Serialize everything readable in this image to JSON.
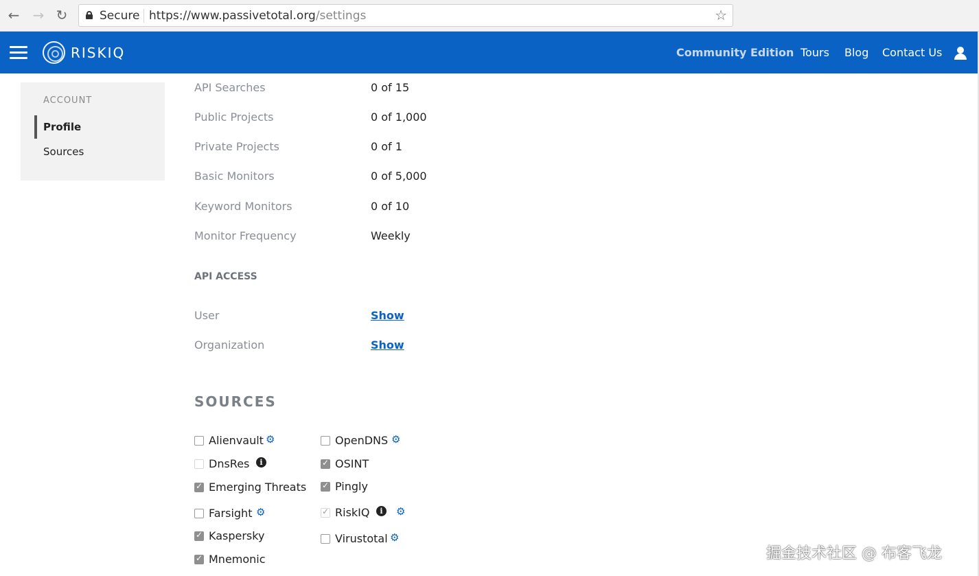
{
  "browser": {
    "secure_label": "Secure",
    "url_host": "https://www.passivetotal.org",
    "url_path": "/settings"
  },
  "header": {
    "logo_text": "RISKIQ",
    "edition": "Community Edition",
    "nav": {
      "tours": "Tours",
      "blog": "Blog",
      "contact": "Contact Us"
    }
  },
  "sidebar": {
    "heading": "ACCOUNT",
    "items": [
      {
        "label": "Profile",
        "active": true
      },
      {
        "label": "Sources",
        "active": false
      }
    ]
  },
  "quotas": [
    {
      "label": "API Searches",
      "value": "0 of 15"
    },
    {
      "label": "Public Projects",
      "value": "0 of 1,000"
    },
    {
      "label": "Private Projects",
      "value": "0 of 1"
    },
    {
      "label": "Basic Monitors",
      "value": "0 of 5,000"
    },
    {
      "label": "Keyword Monitors",
      "value": "0 of 10"
    },
    {
      "label": "Monitor Frequency",
      "value": "Weekly"
    }
  ],
  "api_access": {
    "heading": "API ACCESS",
    "rows": [
      {
        "label": "User",
        "link": "Show"
      },
      {
        "label": "Organization",
        "link": "Show"
      }
    ]
  },
  "sources": {
    "title": "SOURCES",
    "left": [
      {
        "name": "Alienvault",
        "checked": false
      },
      {
        "name": "DnsRes",
        "checked": false
      },
      {
        "name": "Emerging Threats",
        "checked": true
      },
      {
        "name": "Farsight",
        "checked": false
      },
      {
        "name": "Kaspersky",
        "checked": true
      },
      {
        "name": "Mnemonic",
        "checked": true
      }
    ],
    "right": [
      {
        "name": "OpenDNS",
        "checked": false
      },
      {
        "name": "OSINT",
        "checked": true
      },
      {
        "name": "Pingly",
        "checked": true
      },
      {
        "name": "RiskIQ",
        "checked": true
      },
      {
        "name": "Virustotal",
        "checked": false
      }
    ]
  },
  "icons": {
    "gear": "gear-icon",
    "info": "info-icon"
  },
  "colors": {
    "brand": "#0a63c4",
    "link": "#0a63c4"
  },
  "watermark": "掘金技术社区 @ 布客飞龙"
}
